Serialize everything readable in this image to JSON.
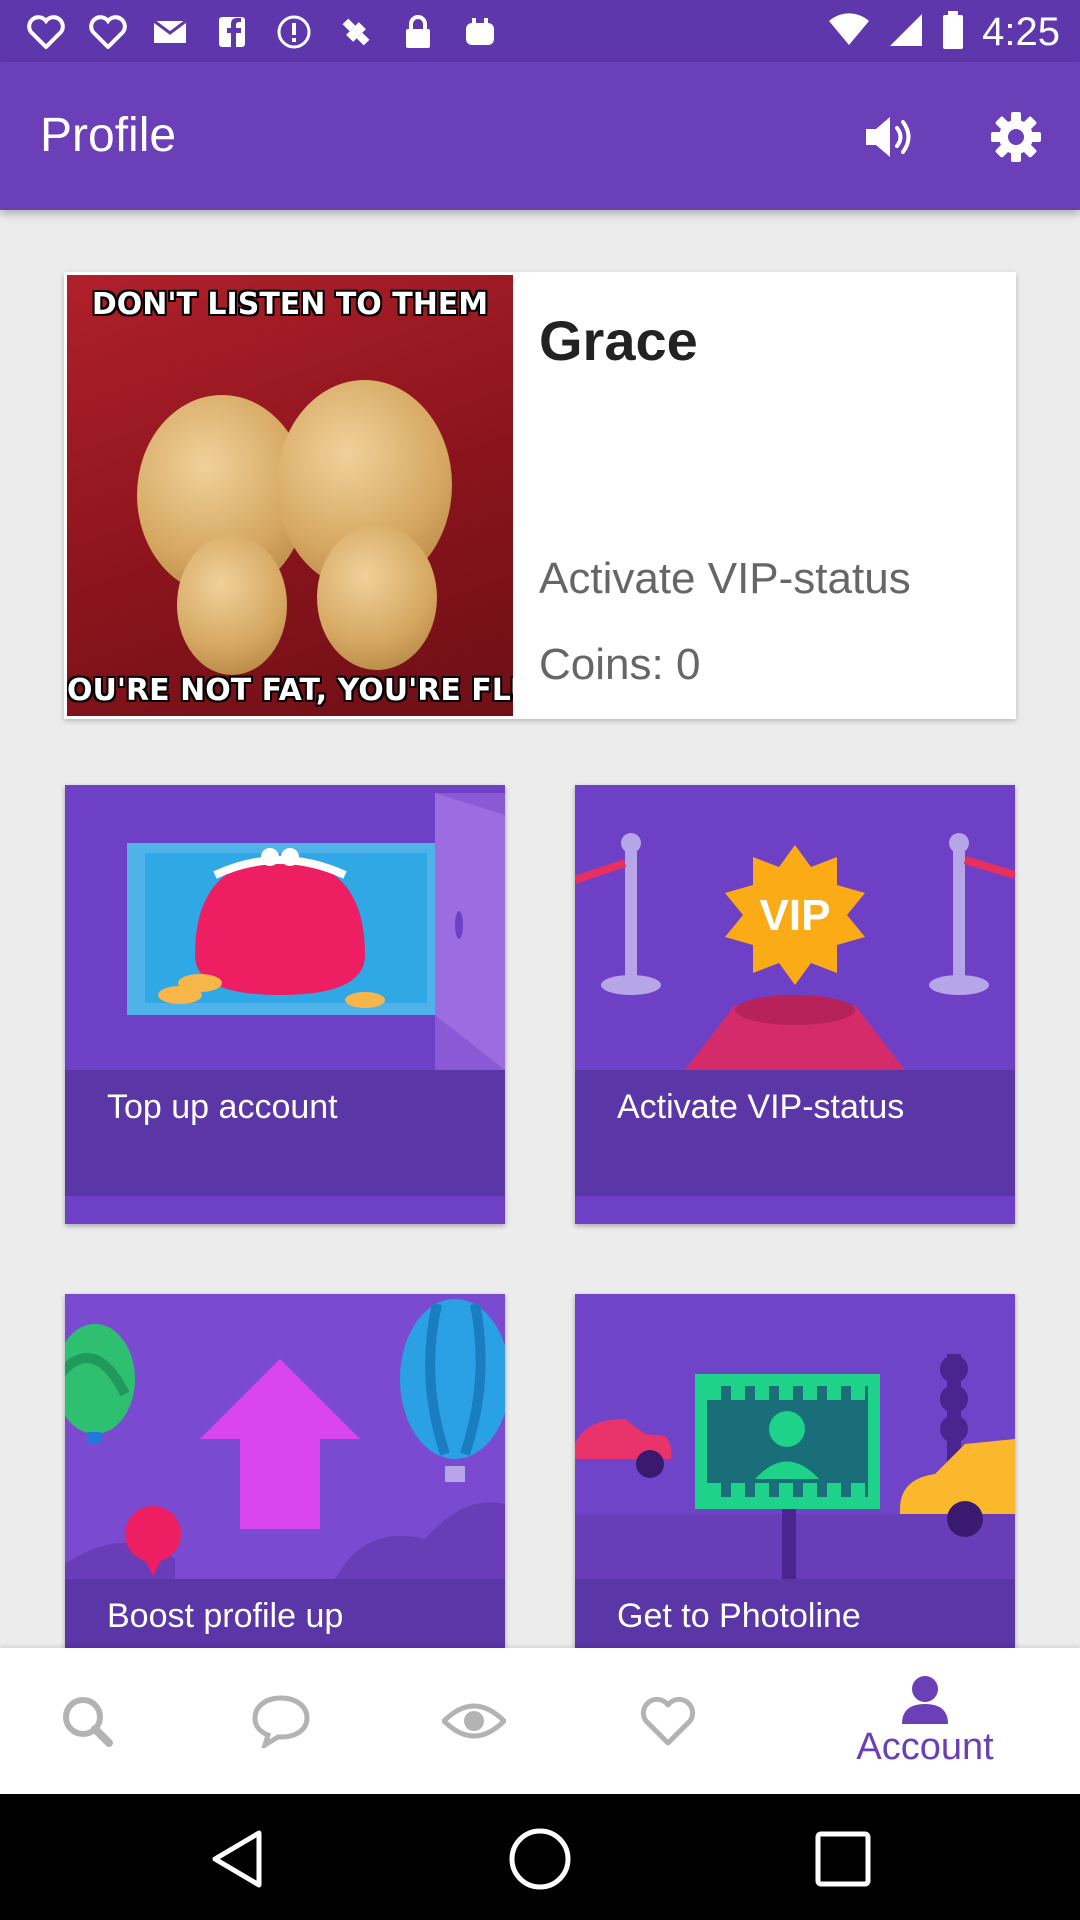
{
  "status_bar": {
    "time": "4:25",
    "left_icons": [
      "heart-outline-icon",
      "heart-outline-icon",
      "mail-icon",
      "facebook-icon",
      "info-icon",
      "fake-gps-icon",
      "lock-icon",
      "app-icon"
    ],
    "right_icons": [
      "wifi-icon",
      "signal-icon",
      "battery-icon"
    ]
  },
  "app_bar": {
    "title": "Profile",
    "actions": [
      "volume-icon",
      "settings-icon"
    ],
    "color": "#6a3fb8"
  },
  "profile": {
    "name": "Grace",
    "vip_status": "Activate VIP-status",
    "coins": "Coins: 0",
    "photo_caption_top": "DON'T LISTEN TO THEM",
    "photo_caption_bottom": "OU'RE NOT FAT, YOU'RE FLUFF"
  },
  "tiles": [
    {
      "label": "Top up account",
      "icon": "purse-icon"
    },
    {
      "label": "Activate VIP-status",
      "icon": "vip-badge-icon",
      "badge_text": "VIP"
    },
    {
      "label": "Boost profile up",
      "icon": "arrow-up-icon"
    },
    {
      "label": "Get to Photoline",
      "icon": "photo-billboard-icon"
    }
  ],
  "bottom_nav": {
    "items": [
      {
        "name": "search",
        "icon": "search-icon"
      },
      {
        "name": "chat",
        "icon": "chat-icon"
      },
      {
        "name": "views",
        "icon": "eye-icon"
      },
      {
        "name": "likes",
        "icon": "heart-icon"
      },
      {
        "name": "account",
        "icon": "account-icon",
        "label": "Account",
        "active": true
      }
    ],
    "active_color": "#6a3fb8",
    "inactive_color": "#b3b3b3"
  },
  "system_nav": [
    "back-icon",
    "home-icon",
    "recent-apps-icon"
  ]
}
